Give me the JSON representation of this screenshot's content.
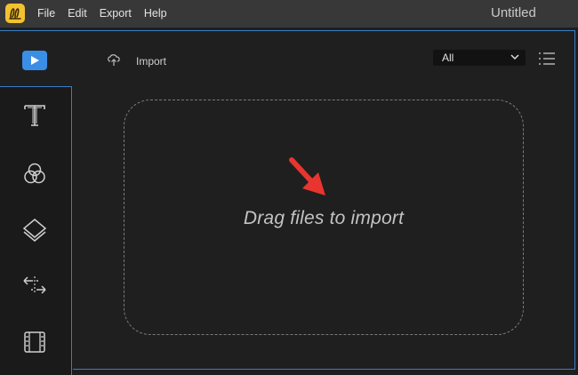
{
  "app": {
    "window_title": "Untitled",
    "menu": [
      "File",
      "Edit",
      "Export",
      "Help"
    ]
  },
  "toolbar": {
    "import_label": "Import",
    "filter_value": "All"
  },
  "sidebar": {
    "items": [
      {
        "icon": "media-icon",
        "active": true
      },
      {
        "icon": "text-icon"
      },
      {
        "icon": "filters-icon"
      },
      {
        "icon": "overlays-icon"
      },
      {
        "icon": "transitions-icon"
      },
      {
        "icon": "elements-icon"
      }
    ]
  },
  "dropzone": {
    "text": "Drag files to import"
  },
  "colors": {
    "accent": "#3a8ee6",
    "arrow": "#e8352f",
    "logo": "#f2c230"
  }
}
